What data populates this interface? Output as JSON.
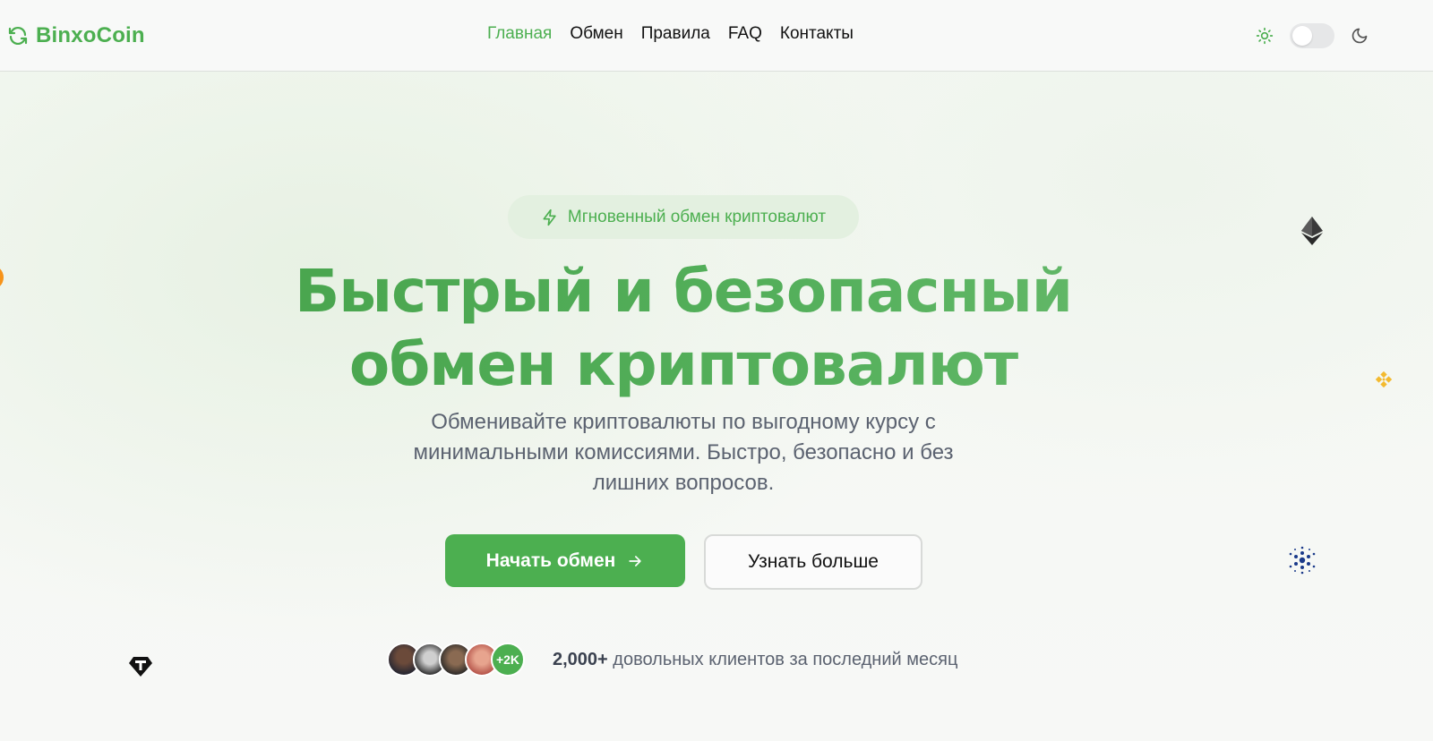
{
  "header": {
    "logo_text": "BinxoCoin",
    "nav": [
      {
        "label": "Главная",
        "active": true
      },
      {
        "label": "Обмен",
        "active": false
      },
      {
        "label": "Правила",
        "active": false
      },
      {
        "label": "FAQ",
        "active": false
      },
      {
        "label": "Контакты",
        "active": false
      }
    ],
    "theme_toggle": {
      "state": "light",
      "icons": [
        "sun-icon",
        "moon-icon"
      ]
    }
  },
  "hero": {
    "badge": "Мгновенный обмен криптовалют",
    "title_line1": "Быстрый и безопасный",
    "title_line2": "обмен криптовалют",
    "subtitle": "Обменивайте криптовалюты по выгодному курсу с минимальными комиссиями. Быстро, безопасно и без лишних вопросов.",
    "primary_button": "Начать обмен",
    "secondary_button": "Узнать больше",
    "social_proof": {
      "more_badge": "+2K",
      "count": "2,000+",
      "text": "довольных клиентов за последний месяц"
    }
  },
  "colors": {
    "accent": "#4caf50",
    "badge_bg": "#e3f0e0",
    "text_muted": "#5b6270"
  },
  "decor_icons": [
    "ethereum-icon",
    "binance-icon",
    "cardano-icon",
    "tether-icon",
    "bitcoin-icon"
  ]
}
